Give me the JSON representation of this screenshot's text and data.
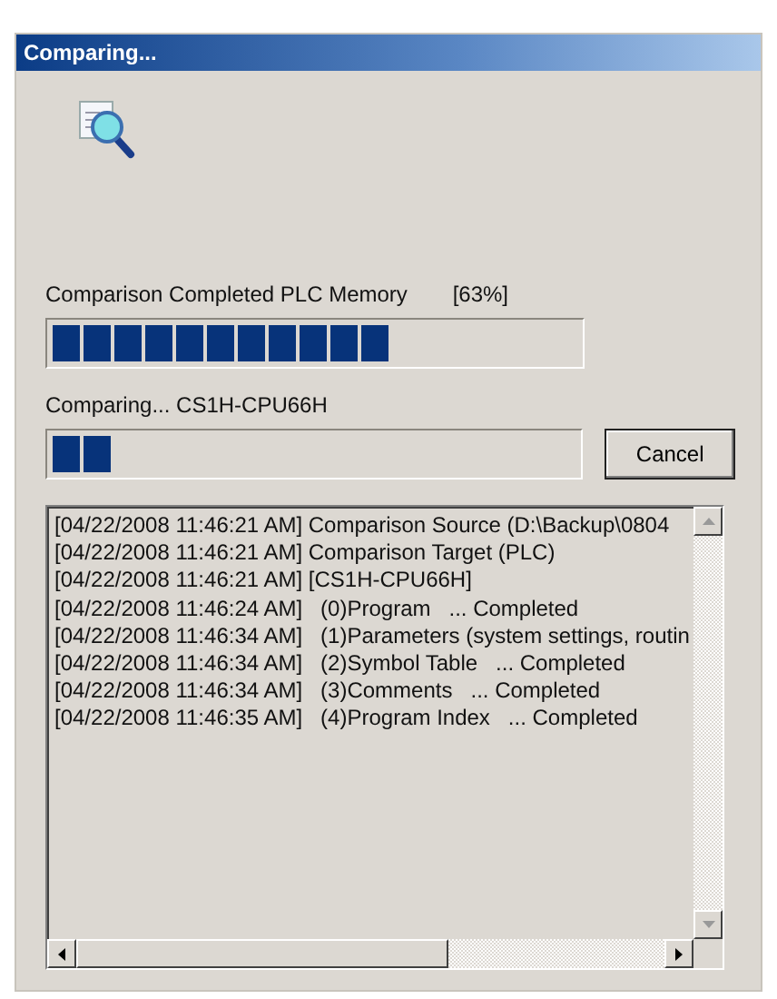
{
  "window": {
    "title": "Comparing..."
  },
  "overall": {
    "label": "Comparison Completed PLC Memory",
    "percent": "[63%]",
    "level": 0.63
  },
  "current": {
    "label": "Comparing... CS1H-CPU66H",
    "level": 0.12
  },
  "buttons": [
    "Cancel"
  ],
  "log": [
    "[04/22/2008 11:46:21 AM] Comparison Source (D:\\Backup\\0804",
    "[04/22/2008 11:46:21 AM] Comparison Target (PLC)",
    "[04/22/2008 11:46:21 AM] [CS1H-CPU66H]",
    "[04/22/2008 11:46:24 AM]   (0)Program   ... Completed",
    "[04/22/2008 11:46:34 AM]   (1)Parameters (system settings, routin",
    "[04/22/2008 11:46:34 AM]   (2)Symbol Table   ... Completed",
    "[04/22/2008 11:46:34 AM]   (3)Comments   ... Completed",
    "[04/22/2008 11:46:35 AM]   (4)Program Index   ... Completed"
  ]
}
